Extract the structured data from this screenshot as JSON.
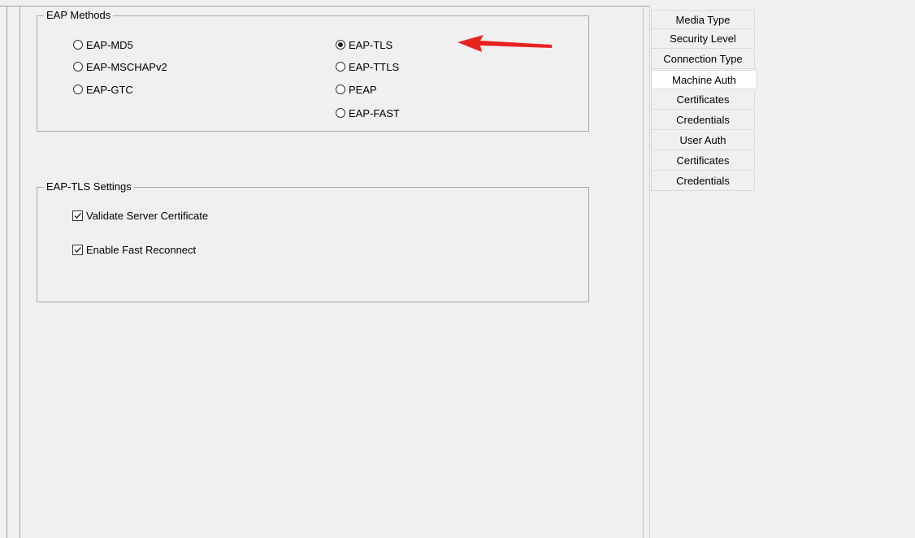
{
  "eap_methods": {
    "legend": "EAP Methods",
    "options": [
      {
        "label": "EAP-MD5",
        "checked": false
      },
      {
        "label": "EAP-MSCHAPv2",
        "checked": false
      },
      {
        "label": "EAP-GTC",
        "checked": false
      },
      {
        "label": "EAP-TLS",
        "checked": true
      },
      {
        "label": "EAP-TTLS",
        "checked": false
      },
      {
        "label": "PEAP",
        "checked": false
      },
      {
        "label": "EAP-FAST",
        "checked": false
      }
    ]
  },
  "eap_tls_settings": {
    "legend": "EAP-TLS Settings",
    "validate_server_certificate": {
      "label": "Validate Server Certificate",
      "checked": true
    },
    "enable_fast_reconnect": {
      "label": "Enable Fast Reconnect",
      "checked": true
    }
  },
  "tabs": [
    {
      "label": "Media Type",
      "selected": false
    },
    {
      "label": "Security Level",
      "selected": false
    },
    {
      "label": "Connection Type",
      "selected": false
    },
    {
      "label": "Machine Auth",
      "selected": true
    },
    {
      "label": "Certificates",
      "selected": false
    },
    {
      "label": "Credentials",
      "selected": false
    },
    {
      "label": "User Auth",
      "selected": false
    },
    {
      "label": "Certificates",
      "selected": false
    },
    {
      "label": "Credentials",
      "selected": false
    }
  ],
  "annotation": {
    "icon": "red-arrow-icon",
    "color": "#e8231f"
  }
}
